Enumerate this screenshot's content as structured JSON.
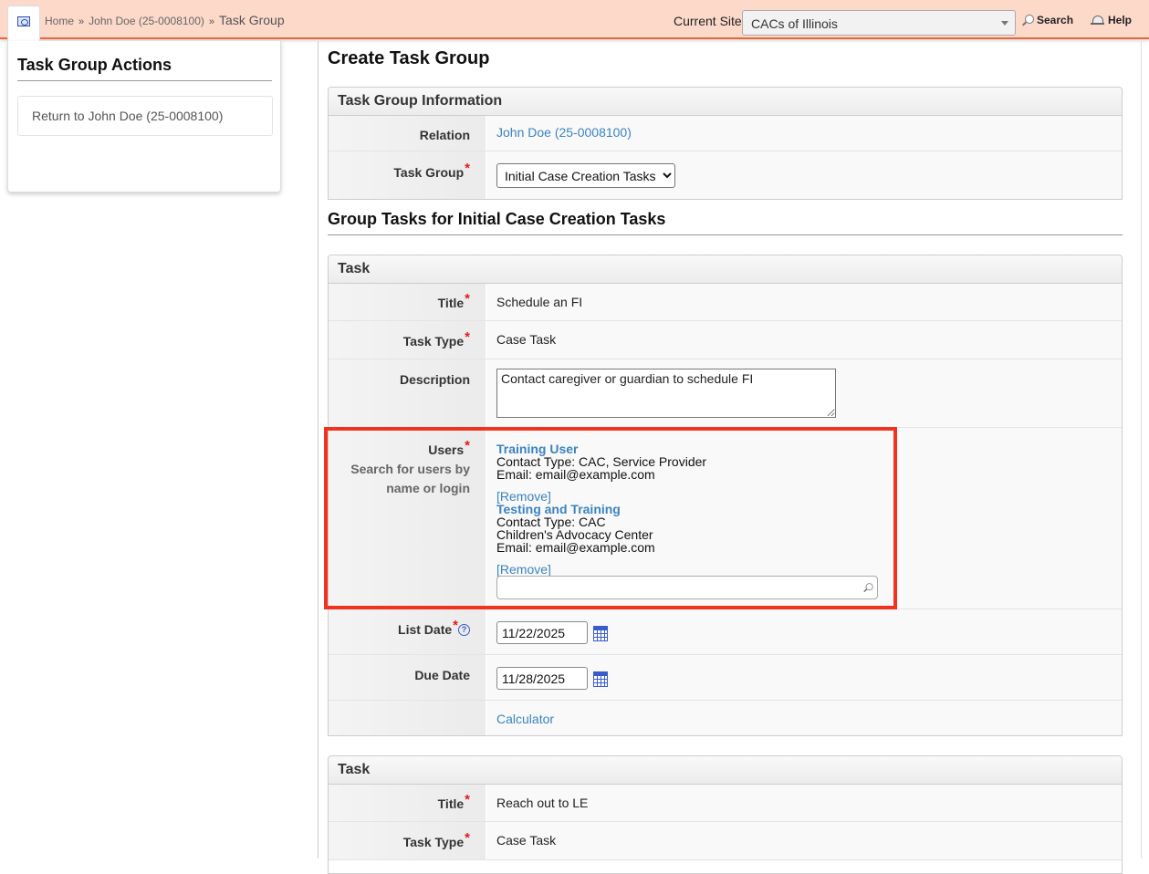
{
  "topbar": {
    "breadcrumb": {
      "home": "Home",
      "person": "John Doe (25-0008100)",
      "current": "Task Group",
      "separator": "»"
    },
    "site_label": "Current Site",
    "site_value": "CACs of Illinois",
    "search_label": "Search",
    "help_label": "Help"
  },
  "sidebar": {
    "title": "Task Group Actions",
    "return_label": "Return to John Doe (25-0008100)"
  },
  "page": {
    "title": "Create Task Group"
  },
  "task_group_info": {
    "heading": "Task Group Information",
    "relation_label": "Relation",
    "relation_value": "John Doe (25-0008100)",
    "task_group_label": "Task Group",
    "task_group_value": "Initial Case Creation Tasks"
  },
  "group_tasks_heading": "Group Tasks for Initial Case Creation Tasks",
  "tasks": [
    {
      "heading": "Task",
      "title_label": "Title",
      "title_value": "Schedule an FI",
      "type_label": "Task Type",
      "type_value": "Case Task",
      "description_label": "Description",
      "description_value": "Contact caregiver or guardian to schedule FI",
      "users_label": "Users",
      "users_hint": "Search for users by name or login",
      "users": [
        {
          "name": "Training User",
          "lines": [
            "Contact Type: CAC, Service Provider",
            "Email: email@example.com"
          ],
          "remove": "[Remove]"
        },
        {
          "name": "Testing and Training",
          "lines": [
            "Contact Type: CAC",
            "Children's Advocacy Center",
            "Email: email@example.com"
          ],
          "remove": "[Remove]"
        }
      ],
      "list_date_label": "List Date",
      "list_date_value": "11/22/2025",
      "help_glyph": "?",
      "due_date_label": "Due Date",
      "due_date_value": "11/28/2025",
      "calculator_label": "Calculator"
    },
    {
      "heading": "Task",
      "title_label": "Title",
      "title_value": "Reach out to LE",
      "type_label": "Task Type",
      "type_value": "Case Task"
    }
  ],
  "required_marker": "*",
  "icons": {
    "home": "home-icon",
    "search": "search-icon",
    "help": "help-icon",
    "calendar": "calendar-icon",
    "help_circle": "help-circle-icon"
  },
  "colors": {
    "topbar_bg": "#fcd9c9",
    "topbar_border": "#e9663a",
    "link": "#3a83c4",
    "required": "#e21b1b",
    "highlight": "#f2321f"
  }
}
